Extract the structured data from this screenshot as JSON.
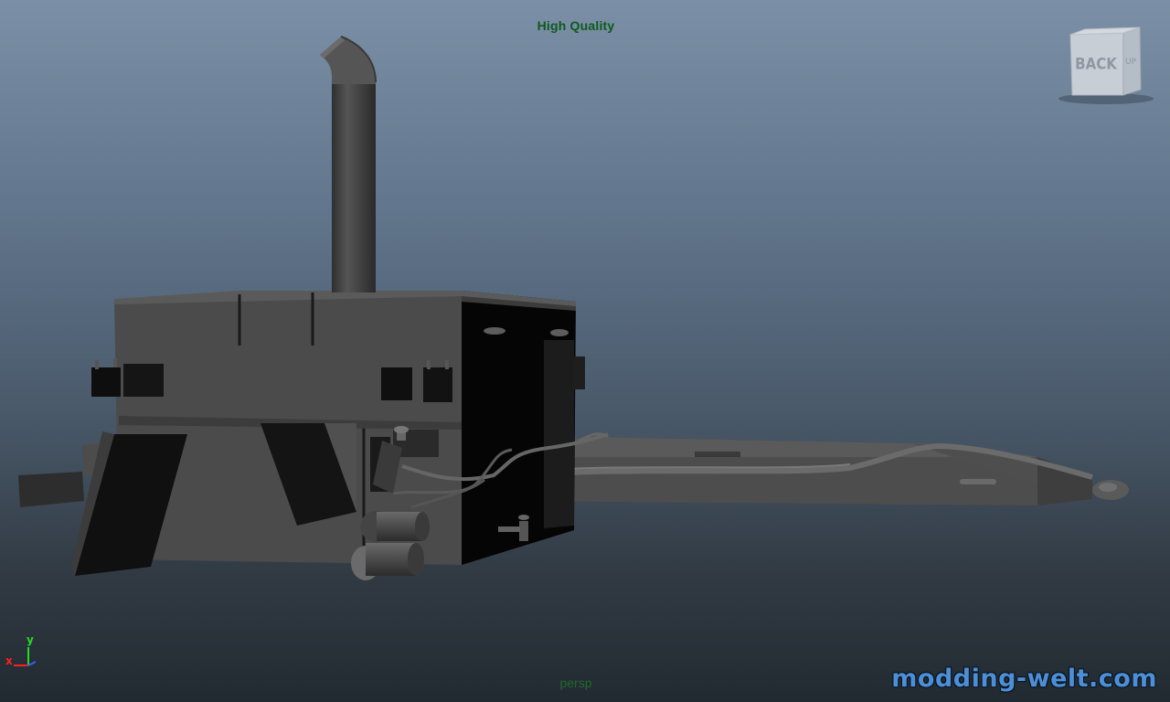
{
  "viewport": {
    "quality_label": "High Quality",
    "camera_name": "persp"
  },
  "viewcube": {
    "front_face_label": "BACK",
    "side_face_label": "UP",
    "icon": "view-cube-icon"
  },
  "axis_gizmo": {
    "x_label": "x",
    "y_label": "y",
    "x_color": "#ff2020",
    "y_color": "#22dd22",
    "z_color": "#3060ff"
  },
  "watermark": {
    "text": "modding-welt.com",
    "color": "#4d8fd6"
  },
  "model": {
    "name": "3d-model-stove",
    "surface_color": "#4a4a4a",
    "shadow_color": "#0a0a0a"
  }
}
